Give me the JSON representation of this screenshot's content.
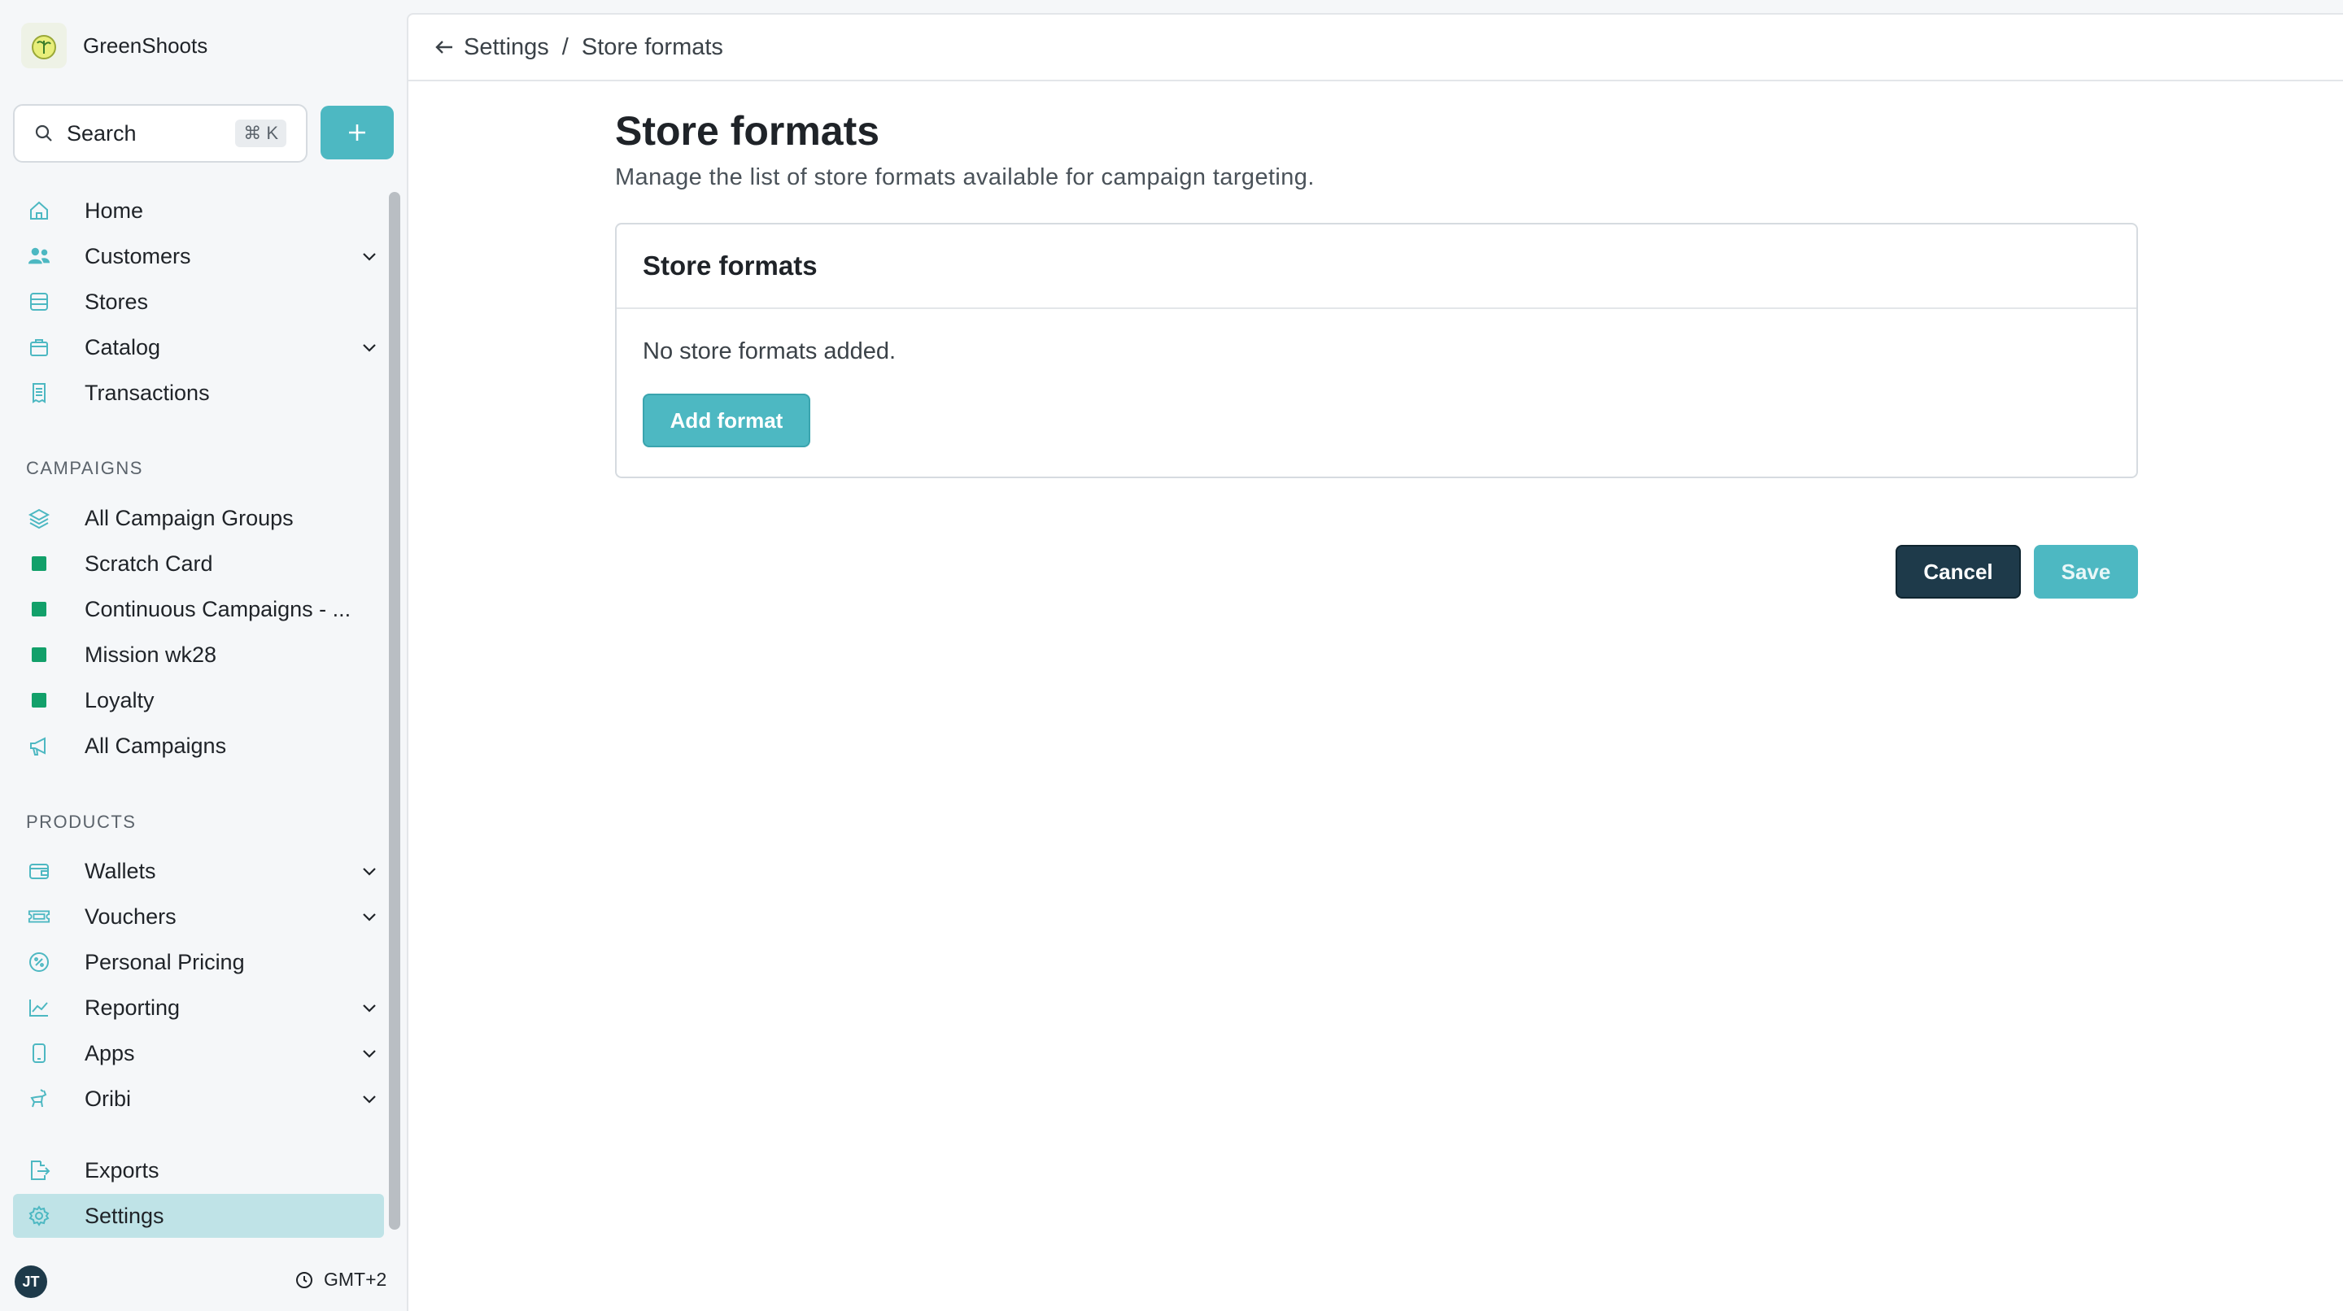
{
  "app": {
    "name": "GreenShoots"
  },
  "search": {
    "label": "Search",
    "shortcut": "⌘ K"
  },
  "nav": {
    "main": [
      {
        "label": "Home",
        "icon": "home-icon"
      },
      {
        "label": "Customers",
        "icon": "users-icon",
        "expandable": true
      },
      {
        "label": "Stores",
        "icon": "store-icon"
      },
      {
        "label": "Catalog",
        "icon": "bag-icon",
        "expandable": true
      },
      {
        "label": "Transactions",
        "icon": "receipt-icon"
      }
    ],
    "campaigns_title": "CAMPAIGNS",
    "campaigns": [
      {
        "label": "All Campaign Groups",
        "icon": "layers-icon"
      },
      {
        "label": "Scratch Card",
        "icon": "square-icon"
      },
      {
        "label": "Continuous Campaigns - ...",
        "icon": "square-icon"
      },
      {
        "label": "Mission wk28",
        "icon": "square-icon"
      },
      {
        "label": "Loyalty",
        "icon": "square-icon"
      },
      {
        "label": "All Campaigns",
        "icon": "megaphone-icon"
      }
    ],
    "products_title": "PRODUCTS",
    "products": [
      {
        "label": "Wallets",
        "icon": "wallet-icon",
        "expandable": true
      },
      {
        "label": "Vouchers",
        "icon": "ticket-icon",
        "expandable": true
      },
      {
        "label": "Personal Pricing",
        "icon": "percent-badge-icon"
      },
      {
        "label": "Reporting",
        "icon": "chart-icon",
        "expandable": true
      },
      {
        "label": "Apps",
        "icon": "phone-icon",
        "expandable": true
      },
      {
        "label": "Oribi",
        "icon": "oribi-icon",
        "expandable": true
      }
    ],
    "bottom": [
      {
        "label": "Exports",
        "icon": "export-icon"
      },
      {
        "label": "Settings",
        "icon": "gear-icon",
        "active": true
      }
    ]
  },
  "footer": {
    "avatar_initials": "JT",
    "timezone": "GMT+2"
  },
  "breadcrumb": {
    "parent": "Settings",
    "separator": "/",
    "current": "Store formats"
  },
  "page": {
    "title": "Store formats",
    "subtitle": "Manage the list of store formats available for campaign targeting."
  },
  "card": {
    "title": "Store formats",
    "empty_message": "No store formats added.",
    "add_button": "Add format"
  },
  "actions": {
    "cancel": "Cancel",
    "save": "Save"
  },
  "colors": {
    "accent": "#4db8c2",
    "dark": "#1e3a4a",
    "active_nav": "#bfe3e7",
    "campaign_square": "#12a06a"
  }
}
